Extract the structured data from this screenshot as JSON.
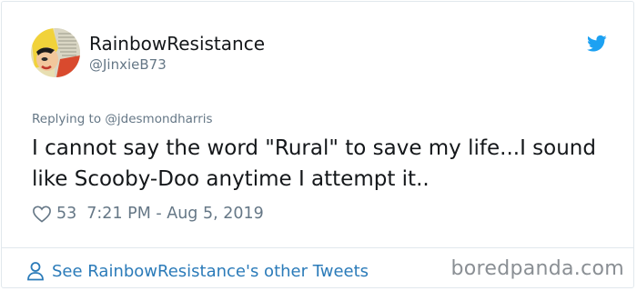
{
  "user": {
    "display_name": "RainbowResistance",
    "handle": "@JinxieB73"
  },
  "tweet": {
    "replying_to": "Replying to @jdesmondharris",
    "text": "I cannot say the word \"Rural\" to save my life...I sound like Scooby-Doo anytime I attempt it..",
    "likes": "53",
    "timestamp": "7:21 PM - Aug 5, 2019"
  },
  "footer": {
    "other_tweets_link": "See RainbowResistance's other Tweets"
  },
  "watermark": "boredpanda.com",
  "icons": {
    "bird": "twitter-bird-icon",
    "heart": "heart-outline-icon",
    "person": "person-outline-icon"
  },
  "colors": {
    "twitter_blue": "#1da1f2",
    "link": "#2b7bb9",
    "secondary_text": "#657786",
    "primary_text": "#14171a",
    "border": "#e1e8ed"
  }
}
